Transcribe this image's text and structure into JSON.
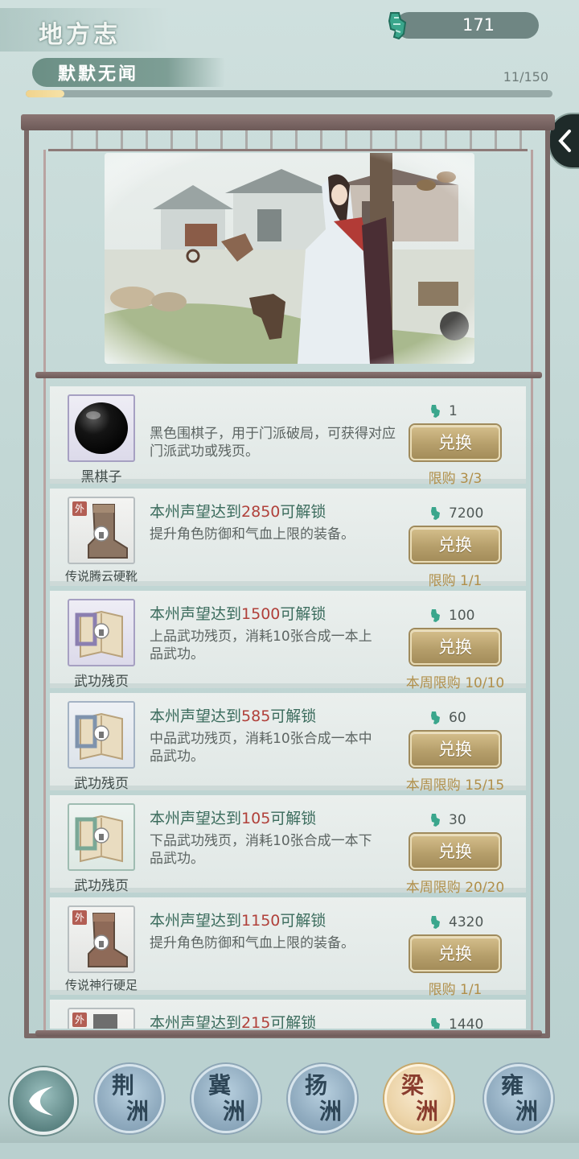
{
  "header": {
    "title": "地方志",
    "reputation_rank": "默默无闻",
    "progress_text": "11/150",
    "progress_fraction": 0.073,
    "currency_value": "171",
    "currency_icon": "jade-token-icon"
  },
  "items": [
    {
      "name": "黑棋子",
      "icon": "black-go-stone-icon",
      "unlock_prefix": "",
      "unlock_number": "",
      "unlock_suffix": "",
      "desc": "黑色围棋子，用于门派破局，可获得对应门派武功或残页。",
      "cost": "1",
      "button": "兑换",
      "limit": "限购 3/3"
    },
    {
      "name": "传说腾云硬靴",
      "icon": "boot-icon",
      "tag": "外",
      "unlock_prefix": "本州声望达到",
      "unlock_number": "2850",
      "unlock_suffix": "可解锁",
      "desc": "提升角色防御和气血上限的装备。",
      "cost": "7200",
      "button": "兑换",
      "limit": "限购 1/1"
    },
    {
      "name": "武功残页",
      "icon": "scroll-page-icon",
      "unlock_prefix": "本州声望达到",
      "unlock_number": "1500",
      "unlock_suffix": "可解锁",
      "desc": "上品武功残页，消耗10张合成一本上品武功。",
      "cost": "100",
      "button": "兑换",
      "limit": "本周限购 10/10"
    },
    {
      "name": "武功残页",
      "icon": "scroll-page-icon",
      "unlock_prefix": "本州声望达到",
      "unlock_number": "585",
      "unlock_suffix": "可解锁",
      "desc": "中品武功残页，消耗10张合成一本中品武功。",
      "cost": "60",
      "button": "兑换",
      "limit": "本周限购 15/15"
    },
    {
      "name": "武功残页",
      "icon": "scroll-page-icon",
      "unlock_prefix": "本州声望达到",
      "unlock_number": "105",
      "unlock_suffix": "可解锁",
      "desc": "下品武功残页，消耗10张合成一本下品武功。",
      "cost": "30",
      "button": "兑换",
      "limit": "本周限购 20/20"
    },
    {
      "name": "传说神行硬足",
      "icon": "boot-icon",
      "tag": "外",
      "unlock_prefix": "本州声望达到",
      "unlock_number": "1150",
      "unlock_suffix": "可解锁",
      "desc": "提升角色防御和气血上限的装备。",
      "cost": "4320",
      "button": "兑换",
      "limit": "限购 1/1"
    },
    {
      "name": "",
      "icon": "equipment-icon",
      "tag": "外",
      "unlock_prefix": "本州声望达到",
      "unlock_number": "215",
      "unlock_suffix": "可解锁",
      "desc": "",
      "cost": "1440",
      "button": "",
      "limit": ""
    }
  ],
  "regions": [
    {
      "c1": "荆",
      "c2": "洲",
      "active": false
    },
    {
      "c1": "冀",
      "c2": "洲",
      "active": false
    },
    {
      "c1": "扬",
      "c2": "洲",
      "active": false
    },
    {
      "c1": "梁",
      "c2": "洲",
      "active": true
    },
    {
      "c1": "雍",
      "c2": "洲",
      "active": false
    }
  ],
  "colors": {
    "accent_gold": "#b69f6b",
    "unlock_red": "#b0403a",
    "unlock_green": "#3a6b5c",
    "frame_brown": "#7b6a68"
  }
}
